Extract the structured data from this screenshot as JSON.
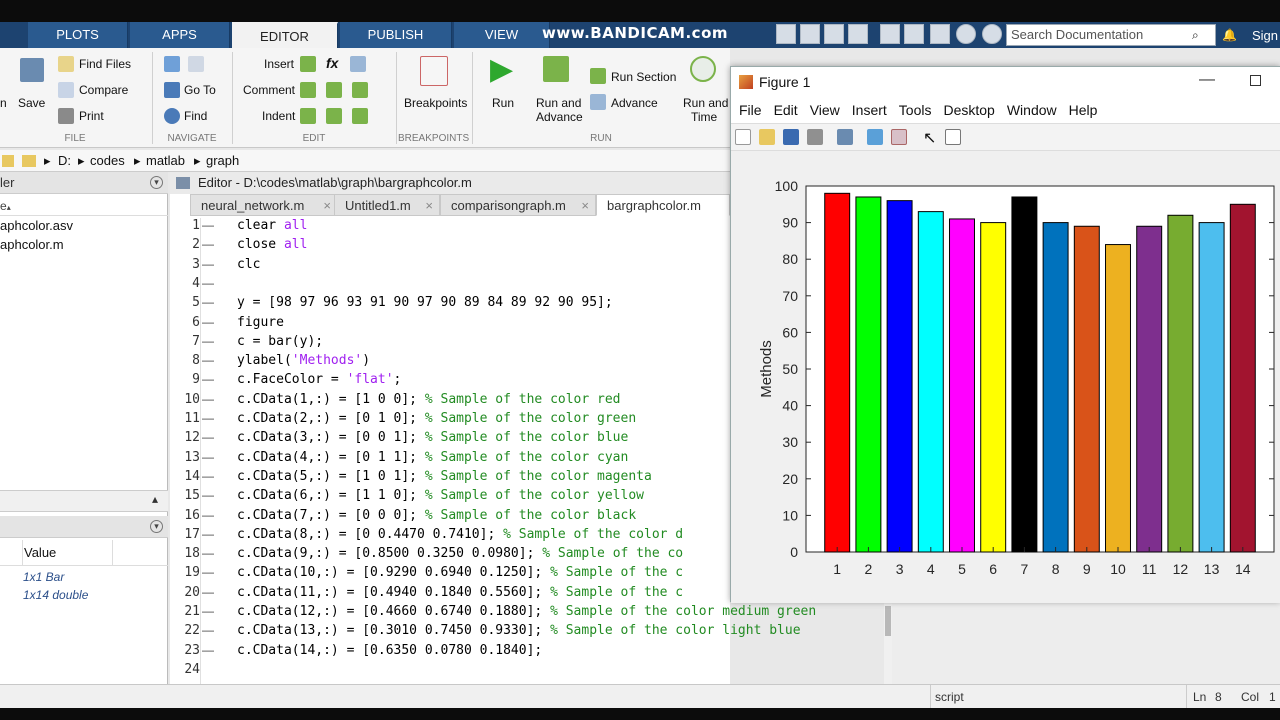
{
  "watermark": "www.BANDICAM.com",
  "ribbon_tabs": [
    "PLOTS",
    "APPS",
    "EDITOR",
    "PUBLISH",
    "VIEW"
  ],
  "search_placeholder": "Search Documentation",
  "sign_in": "Sign",
  "toolstrip": {
    "file": {
      "find_files": "Find Files",
      "compare": "Compare",
      "print": "Print",
      "save": "Save",
      "open": "n",
      "section": "FILE"
    },
    "navigate": {
      "go_to": "Go To",
      "find": "Find",
      "section": "NAVIGATE"
    },
    "edit": {
      "insert": "Insert",
      "comment": "Comment",
      "indent": "Indent",
      "section": "EDIT",
      "fx": "fx"
    },
    "breakpoints": {
      "label": "Breakpoints",
      "section": "BREAKPOINTS"
    },
    "run": {
      "run": "Run",
      "run_and_advance_1": "Run and",
      "run_and_advance_2": "Advance",
      "run_section": "Run Section",
      "advance": "Advance",
      "run_and_time_1": "Run and",
      "run_and_time_2": "Time",
      "section": "RUN"
    }
  },
  "address": {
    "drive": "D:",
    "p1": "codes",
    "p2": "matlab",
    "p3": "graph"
  },
  "left_panel": {
    "header": "ler",
    "sort_label": "e",
    "files": [
      "aphcolor.asv",
      "aphcolor.m"
    ],
    "value_header": "Value",
    "values": [
      "1x1 Bar",
      "1x14 double"
    ]
  },
  "editor": {
    "title": "Editor - D:\\codes\\matlab\\graph\\bargraphcolor.m",
    "tabs": [
      "neural_network.m",
      "Untitled1.m",
      "comparisongraph.m",
      "bargraphcolor.m"
    ],
    "lines": [
      {
        "n": "1",
        "code": "clear ",
        "str": "all",
        "cmt": ""
      },
      {
        "n": "2",
        "code": "close ",
        "str": "all",
        "cmt": ""
      },
      {
        "n": "3",
        "code": "clc",
        "str": "",
        "cmt": ""
      },
      {
        "n": "4",
        "code": "",
        "str": "",
        "cmt": ""
      },
      {
        "n": "5",
        "code": "y = [98 97 96 93 91 90 97 90 89 84 89 92 90 95];",
        "str": "",
        "cmt": ""
      },
      {
        "n": "6",
        "code": "figure",
        "str": "",
        "cmt": ""
      },
      {
        "n": "7",
        "code": "c = bar(y);",
        "str": "",
        "cmt": ""
      },
      {
        "n": "8",
        "code": "ylabel(",
        "str": "'Methods'",
        "cmt": "",
        "tail": ")"
      },
      {
        "n": "9",
        "code": "c.FaceColor = ",
        "str": "'flat'",
        "cmt": "",
        "tail": ";"
      },
      {
        "n": "10",
        "code": "c.CData(1,:) = [1 0 0]; ",
        "str": "",
        "cmt": "% Sample of the color red"
      },
      {
        "n": "11",
        "code": "c.CData(2,:) = [0 1 0]; ",
        "str": "",
        "cmt": "% Sample of the color green"
      },
      {
        "n": "12",
        "code": "c.CData(3,:) = [0 0 1]; ",
        "str": "",
        "cmt": "% Sample of the color blue"
      },
      {
        "n": "13",
        "code": "c.CData(4,:) = [0 1 1]; ",
        "str": "",
        "cmt": "% Sample of the color cyan"
      },
      {
        "n": "14",
        "code": "c.CData(5,:) = [1 0 1]; ",
        "str": "",
        "cmt": "% Sample of the color magenta"
      },
      {
        "n": "15",
        "code": "c.CData(6,:) = [1 1 0]; ",
        "str": "",
        "cmt": "% Sample of the color yellow"
      },
      {
        "n": "16",
        "code": "c.CData(7,:) = [0 0 0]; ",
        "str": "",
        "cmt": "% Sample of the color black"
      },
      {
        "n": "17",
        "code": "c.CData(8,:) = [0 0.4470 0.7410]; ",
        "str": "",
        "cmt": "% Sample of the color d"
      },
      {
        "n": "18",
        "code": "c.CData(9,:) = [0.8500 0.3250 0.0980]; ",
        "str": "",
        "cmt": "% Sample of the co"
      },
      {
        "n": "19",
        "code": "c.CData(10,:) = [0.9290 0.6940 0.1250]; ",
        "str": "",
        "cmt": "% Sample of the c"
      },
      {
        "n": "20",
        "code": "c.CData(11,:) = [0.4940 0.1840 0.5560]; ",
        "str": "",
        "cmt": "% Sample of the c"
      },
      {
        "n": "21",
        "code": "c.CData(12,:) = [0.4660 0.6740 0.1880]; ",
        "str": "",
        "cmt": "% Sample of the color medium green"
      },
      {
        "n": "22",
        "code": "c.CData(13,:) = [0.3010 0.7450 0.9330]; ",
        "str": "",
        "cmt": "% Sample of the color light blue"
      },
      {
        "n": "23",
        "code": "c.CData(14,:) = [0.6350 0.0780 0.1840];",
        "str": "",
        "cmt": ""
      },
      {
        "n": "24",
        "code": "",
        "str": "",
        "cmt": ""
      }
    ]
  },
  "figure": {
    "title": "Figure 1",
    "menus": [
      "File",
      "Edit",
      "View",
      "Insert",
      "Tools",
      "Desktop",
      "Window",
      "Help"
    ]
  },
  "chart_data": {
    "type": "bar",
    "categories": [
      "1",
      "2",
      "3",
      "4",
      "5",
      "6",
      "7",
      "8",
      "9",
      "10",
      "11",
      "12",
      "13",
      "14"
    ],
    "values": [
      98,
      97,
      96,
      93,
      91,
      90,
      97,
      90,
      89,
      84,
      89,
      92,
      90,
      95
    ],
    "colors": [
      "#ff0000",
      "#00ff00",
      "#0000ff",
      "#00ffff",
      "#ff00ff",
      "#ffff00",
      "#000000",
      "#0072bd",
      "#d95319",
      "#edb120",
      "#7e2f8e",
      "#77ac30",
      "#4dbeee",
      "#a2142f"
    ],
    "title": "",
    "xlabel": "",
    "ylabel": "Methods",
    "ylim": [
      0,
      100
    ],
    "yticks": [
      0,
      10,
      20,
      30,
      40,
      50,
      60,
      70,
      80,
      90,
      100
    ],
    "grid": false
  },
  "status": {
    "mode": "script",
    "ln": "Ln",
    "ln_val": "8",
    "col": "Col",
    "col_val": "1"
  }
}
